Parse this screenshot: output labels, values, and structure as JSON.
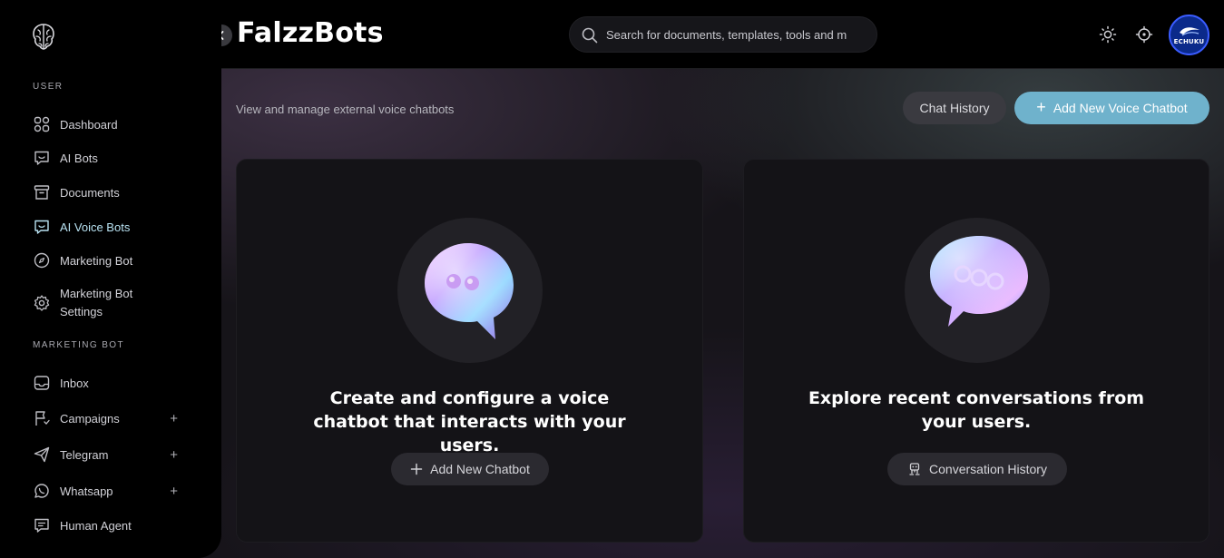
{
  "header": {
    "brand": "FalzzBots",
    "search_placeholder": "Search for documents, templates, tools and m",
    "avatar_label": "ECHUKU"
  },
  "sidebar": {
    "section_user": "USER",
    "section_marketing": "MARKETING BOT",
    "items": [
      {
        "label": "Dashboard"
      },
      {
        "label": "AI Bots"
      },
      {
        "label": "Documents"
      },
      {
        "label": "AI Voice Bots"
      },
      {
        "label": "Marketing Bot"
      },
      {
        "label": "Marketing Bot Settings"
      },
      {
        "label": "Inbox"
      },
      {
        "label": "Campaigns"
      },
      {
        "label": "Telegram"
      },
      {
        "label": "Whatsapp"
      },
      {
        "label": "Human Agent"
      }
    ],
    "plus": "+",
    "settings_line1": "Marketing Bot",
    "settings_line2": "Settings"
  },
  "page": {
    "subtitle": "View and manage external voice chatbots",
    "chat_history_label": "Chat History",
    "add_voice_label": "Add New Voice Chatbot",
    "plus": "+"
  },
  "cards": [
    {
      "heading": "Create and configure a voice chatbot that interacts with your users.",
      "button_label": "Add New Chatbot"
    },
    {
      "heading": "Explore recent conversations from your users.",
      "button_label": "Conversation History"
    }
  ],
  "colors": {
    "accent": "#6fb2cc",
    "active_nav": "#b9e3f3",
    "card_bg": "#141317"
  }
}
